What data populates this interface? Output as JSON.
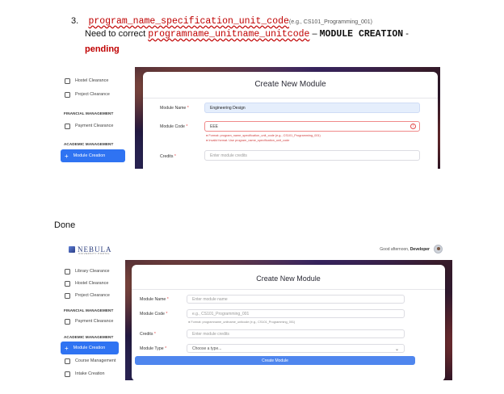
{
  "notes": {
    "number": "3.",
    "spec_code": "program_name_specification_unit_code",
    "spec_example": "(e.g., CS101_Programming_001)",
    "line2_prefix": "Need to correct ",
    "line2_code": "programname_unitname_unitcode",
    "line2_dash": " – ",
    "line2_tag": "MODULE CREATION",
    "line2_trail": " -",
    "pending": "pending",
    "done": "Done"
  },
  "before": {
    "sidebar": {
      "items": [
        {
          "label": "Hostel Clearance",
          "icon": "document-icon"
        },
        {
          "label": "Project Clearance",
          "icon": "briefcase-icon"
        }
      ],
      "section_financial": "FINANCIAL MANAGEMENT",
      "payment": "Payment Clearance",
      "section_academic": "ACADEMIC MANAGEMENT",
      "module_creation": "Module Creation"
    },
    "form": {
      "title": "Create New Module",
      "module_name_label": "Module Name",
      "module_name_value": "Engineering Design",
      "module_code_label": "Module Code",
      "module_code_value": "EEE",
      "format_hint": "Format: program_name_specification_unit_code (e.g., CS101_Programming_001)",
      "error_hint": "Invalid format. Use program_name_specification_unit_code",
      "credits_label": "Credits",
      "credits_placeholder": "Enter module credits",
      "required_mark": "*"
    }
  },
  "after": {
    "header": {
      "logo": "NEBULA",
      "logo_sub": "UNIVERSITY PORTAL",
      "greeting": "Good afternoon, ",
      "user": "Developer"
    },
    "sidebar": {
      "items": [
        {
          "label": "Library Clearance",
          "icon": "book-icon"
        },
        {
          "label": "Hostel Clearance",
          "icon": "document-icon"
        },
        {
          "label": "Project Clearance",
          "icon": "briefcase-icon"
        }
      ],
      "section_financial": "FINANCIAL MANAGEMENT",
      "payment": "Payment Clearance",
      "section_academic": "ACADEMIC MANAGEMENT",
      "module_creation": "Module Creation",
      "course_management": "Course Management",
      "intake_creation": "Intake Creation"
    },
    "form": {
      "title": "Create New Module",
      "module_name_label": "Module Name",
      "module_name_placeholder": "Enter module name",
      "module_code_label": "Module Code",
      "module_code_placeholder": "e.g., CS101_Programming_001",
      "format_hint": "Format: programname_unitname_unitcode (e.g., CS101_Programming_001)",
      "credits_label": "Credits",
      "credits_placeholder": "Enter module credits",
      "module_type_label": "Module Type",
      "module_type_value": "Choose a type...",
      "submit": "Create Module",
      "required_mark": "*"
    }
  }
}
